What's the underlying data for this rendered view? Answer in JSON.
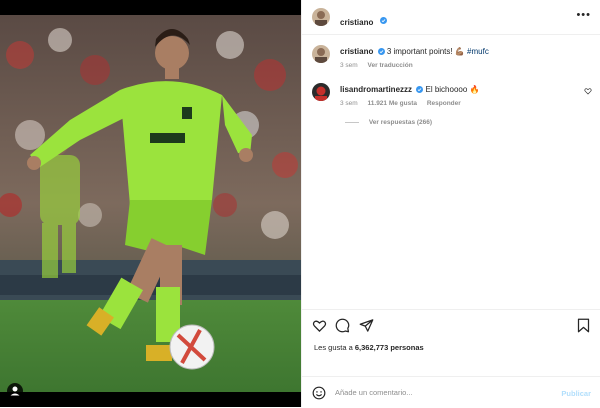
{
  "post": {
    "author": "cristiano",
    "caption": {
      "author": "cristiano",
      "text": "3 important points! 💪🏽",
      "hashtag": "#mufc",
      "time": "3 sem",
      "translate": "Ver traducción"
    },
    "comments": [
      {
        "author": "lisandromartinezzz",
        "text": "El bichoooo 🔥",
        "time": "3 sem",
        "likes": "11.921 Me gusta",
        "reply": "Responder",
        "view_replies": "Ver respuestas (266)"
      }
    ],
    "likes_prefix": "Les gusta a",
    "likes_count": "6,362,773",
    "likes_suffix": "personas"
  },
  "composer": {
    "placeholder": "Añade un comentario...",
    "publish": "Publicar"
  },
  "icons": {
    "more": "more-options-icon",
    "verified": "verified-badge-icon",
    "like": "heart-icon",
    "comment": "comment-icon",
    "share": "share-icon",
    "save": "bookmark-icon",
    "emoji": "emoji-icon",
    "tag": "user-tag-icon"
  },
  "colors": {
    "verified": "#3897f0",
    "hashtag": "#00376b",
    "publish_disabled": "#b2dffc",
    "muted": "#8e8e8e"
  }
}
